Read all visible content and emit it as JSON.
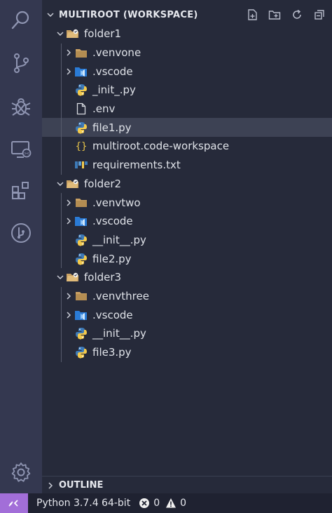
{
  "explorer": {
    "workspace_title": "MULTIROOT (WORKSPACE)",
    "header_actions": [
      "new-file-icon",
      "new-folder-icon",
      "refresh-icon",
      "collapse-all-icon"
    ]
  },
  "tree": [
    {
      "label": "folder1",
      "type": "root-folder",
      "depth": 0,
      "expanded": true
    },
    {
      "label": ".venvone",
      "type": "folder",
      "depth": 1,
      "expanded": false
    },
    {
      "label": ".vscode",
      "type": "vscode-folder",
      "depth": 1,
      "expanded": false
    },
    {
      "label": "_init_.py",
      "type": "python",
      "depth": 1
    },
    {
      "label": ".env",
      "type": "file",
      "depth": 1
    },
    {
      "label": "file1.py",
      "type": "python",
      "depth": 1,
      "selected": true
    },
    {
      "label": "multiroot.code-workspace",
      "type": "json",
      "depth": 1
    },
    {
      "label": "requirements.txt",
      "type": "requirements",
      "depth": 1
    },
    {
      "label": "folder2",
      "type": "root-folder",
      "depth": 0,
      "expanded": true
    },
    {
      "label": ".venvtwo",
      "type": "folder",
      "depth": 1,
      "expanded": false
    },
    {
      "label": ".vscode",
      "type": "vscode-folder",
      "depth": 1,
      "expanded": false
    },
    {
      "label": "__init__.py",
      "type": "python",
      "depth": 1
    },
    {
      "label": "file2.py",
      "type": "python",
      "depth": 1
    },
    {
      "label": "folder3",
      "type": "root-folder",
      "depth": 0,
      "expanded": true
    },
    {
      "label": ".venvthree",
      "type": "folder",
      "depth": 1,
      "expanded": false
    },
    {
      "label": ".vscode",
      "type": "vscode-folder",
      "depth": 1,
      "expanded": false
    },
    {
      "label": "__init__.py",
      "type": "python",
      "depth": 1
    },
    {
      "label": "file3.py",
      "type": "python",
      "depth": 1
    }
  ],
  "outline": {
    "title": "OUTLINE"
  },
  "activity_bar": [
    "search-icon",
    "source-control-icon",
    "debug-icon",
    "remote-explorer-icon",
    "extensions-icon",
    "git-graph-icon",
    "settings-gear-icon"
  ],
  "status_bar": {
    "interpreter": "Python 3.7.4 64-bit",
    "errors": "0",
    "warnings": "0"
  },
  "colors": {
    "accent_purple": "#a26ed8",
    "selection": "#3d4254",
    "folder_tan": "#c8a063",
    "python_blue": "#3d7ab8",
    "python_yellow": "#f2c94c",
    "vscode_blue": "#2a7bd6"
  }
}
